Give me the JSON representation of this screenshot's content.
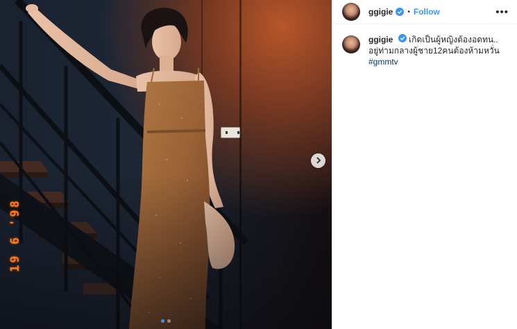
{
  "post": {
    "username": "ggigie",
    "follow_label": "Follow",
    "separator": "•",
    "more_label": "•••",
    "caption_text": "เกิดเป็นผู้หญิงต้องอดทน.. อยู่ท่ามกลางผู้ชาย12คนต้องห้ามหวั่น ",
    "hashtag": "#gmmtv",
    "date_stamp": "19 6 '98",
    "carousel": {
      "total": 2,
      "current": 1
    }
  },
  "colors": {
    "accent": "#3897f0",
    "hashtag": "#003569",
    "date_stamp": "#ff7a1a"
  },
  "icons": {
    "verified": "verified-badge-icon",
    "next": "chevron-right-icon"
  }
}
